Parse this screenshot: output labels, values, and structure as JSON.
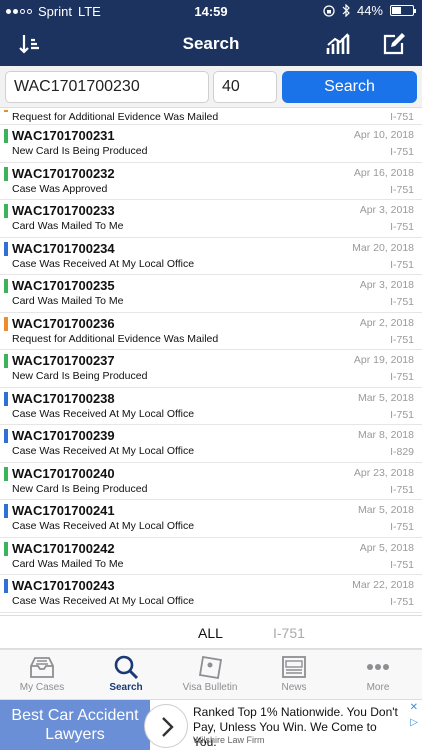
{
  "status_bar": {
    "carrier": "Sprint",
    "network": "LTE",
    "time": "14:59",
    "battery": "44%"
  },
  "nav": {
    "title": "Search",
    "left_icon": "sort-icon",
    "right_icons": [
      "chart-icon",
      "edit-icon"
    ]
  },
  "search": {
    "case_id": "WAC1701700230",
    "count": "40",
    "button": "Search"
  },
  "cases": [
    {
      "partial": true,
      "status": "Request for Additional Evidence Was Mailed",
      "form": "I-751",
      "color": "#f08a2e"
    },
    {
      "id": "WAC1701700231",
      "status": "New Card Is Being Produced",
      "date": "Apr 10, 2018",
      "form": "I-751",
      "color": "#3cb25b"
    },
    {
      "id": "WAC1701700232",
      "status": "Case Was Approved",
      "date": "Apr 16, 2018",
      "form": "I-751",
      "color": "#3cb25b"
    },
    {
      "id": "WAC1701700233",
      "status": "Card Was Mailed To Me",
      "date": "Apr 3, 2018",
      "form": "I-751",
      "color": "#3cb25b"
    },
    {
      "id": "WAC1701700234",
      "status": "Case Was Received At My Local Office",
      "date": "Mar 20, 2018",
      "form": "I-751",
      "color": "#2f6fd6"
    },
    {
      "id": "WAC1701700235",
      "status": "Card Was Mailed To Me",
      "date": "Apr 3, 2018",
      "form": "I-751",
      "color": "#3cb25b"
    },
    {
      "id": "WAC1701700236",
      "status": "Request for Additional Evidence Was Mailed",
      "date": "Apr 2, 2018",
      "form": "I-751",
      "color": "#f08a2e"
    },
    {
      "id": "WAC1701700237",
      "status": "New Card Is Being Produced",
      "date": "Apr 19, 2018",
      "form": "I-751",
      "color": "#3cb25b"
    },
    {
      "id": "WAC1701700238",
      "status": "Case Was Received At My Local Office",
      "date": "Mar 5, 2018",
      "form": "I-751",
      "color": "#2f6fd6"
    },
    {
      "id": "WAC1701700239",
      "status": "Case Was Received At My Local Office",
      "date": "Mar 8, 2018",
      "form": "I-829",
      "color": "#2f6fd6"
    },
    {
      "id": "WAC1701700240",
      "status": "New Card Is Being Produced",
      "date": "Apr 23, 2018",
      "form": "I-751",
      "color": "#3cb25b"
    },
    {
      "id": "WAC1701700241",
      "status": "Case Was Received At My Local Office",
      "date": "Mar 5, 2018",
      "form": "I-751",
      "color": "#2f6fd6"
    },
    {
      "id": "WAC1701700242",
      "status": "Card Was Mailed To Me",
      "date": "Apr 5, 2018",
      "form": "I-751",
      "color": "#3cb25b"
    },
    {
      "id": "WAC1701700243",
      "status": "Case Was Received At My Local Office",
      "date": "Mar 22, 2018",
      "form": "I-751",
      "color": "#2f6fd6"
    }
  ],
  "segments": {
    "all": "ALL",
    "i751": "I-751"
  },
  "tabs": [
    {
      "label": "My Cases",
      "icon": "inbox-icon",
      "active": false
    },
    {
      "label": "Search",
      "icon": "search-icon",
      "active": true
    },
    {
      "label": "Visa Bulletin",
      "icon": "note-icon",
      "active": false
    },
    {
      "label": "News",
      "icon": "news-icon",
      "active": false
    },
    {
      "label": "More",
      "icon": "more-icon",
      "active": false
    }
  ],
  "ad": {
    "left_text": "Best Car Accident Lawyers",
    "text": "Ranked Top 1% Nationwide. You Don't Pay, Unless You Win. We Come to You.",
    "sub": "Wilshire Law Firm"
  },
  "colors": {
    "nav": "#1c3360",
    "accent": "#1a73e8",
    "tab_active": "#1a3a75"
  }
}
